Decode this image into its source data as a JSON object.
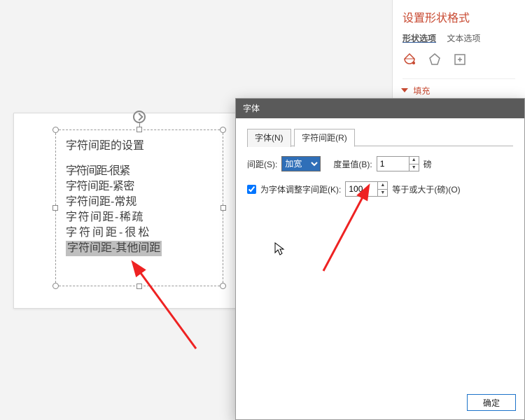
{
  "format_pane": {
    "title": "设置形状格式",
    "tab_shape": "形状选项",
    "tab_text": "文本选项",
    "fill_label": "填充"
  },
  "textbox": {
    "title": "字符间距的设置",
    "lines": [
      "字符间距-很紧",
      "字符间距-紧密",
      "字符间距-常规",
      "字符间距-稀疏",
      "字符间距-很松",
      "字符间距-其他间距"
    ]
  },
  "dialog": {
    "title": "字体",
    "tab_font": "字体(N)",
    "tab_spacing": "字符间距(R)",
    "spacing_label": "间距(S):",
    "spacing_select": "加宽",
    "measure_label": "度量值(B):",
    "measure_value": "1",
    "measure_unit": "磅",
    "kerning_checkbox_label": "为字体调整字间距(K):",
    "kerning_value": "100",
    "kerning_suffix": "等于或大于(磅)(O)",
    "ok": "确定"
  }
}
